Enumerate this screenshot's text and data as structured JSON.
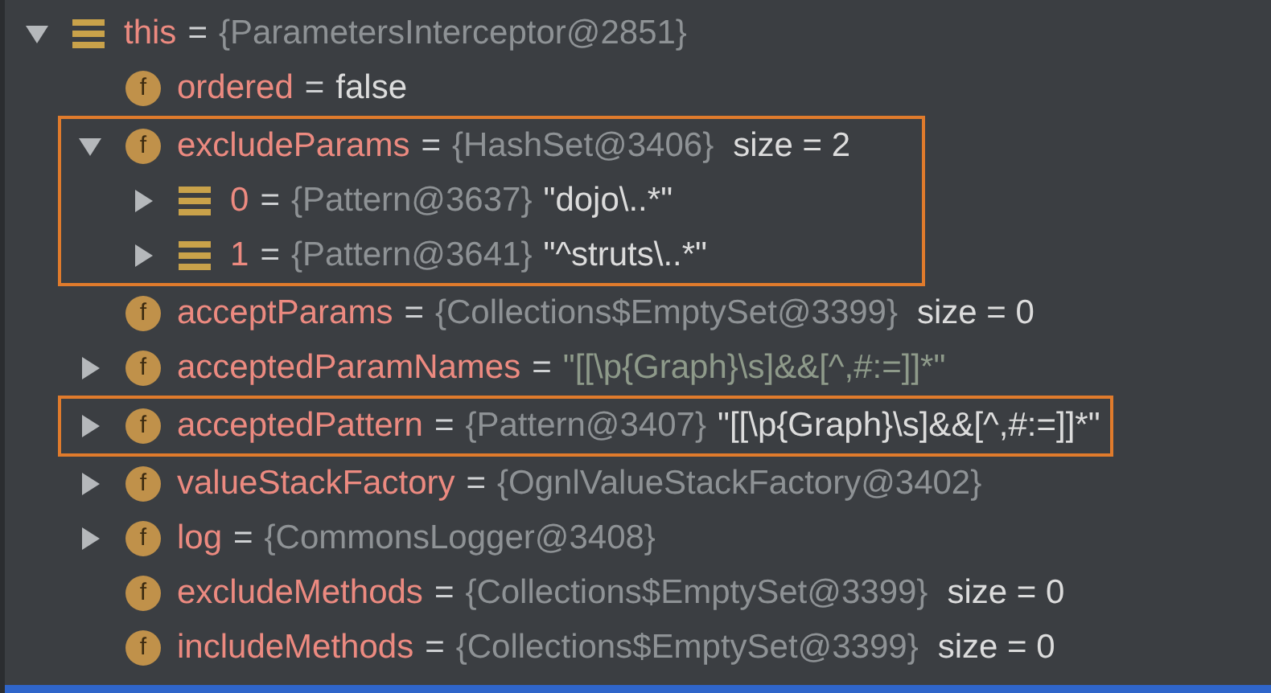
{
  "tree": [
    {
      "kind": "object",
      "name": "this",
      "eq": "=",
      "type": "{ParametersInterceptor@2851}",
      "has_children": true,
      "expanded": true,
      "highlighted": false,
      "children": [
        {
          "kind": "field",
          "badge": "f",
          "name": "ordered",
          "eq": "=",
          "value": "false",
          "has_children": false,
          "highlighted": false
        },
        {
          "kind": "field",
          "badge": "f",
          "name": "excludeParams",
          "eq": "=",
          "type": "{HashSet@3406}",
          "size": "size = 2",
          "has_children": true,
          "expanded": true,
          "highlighted": true,
          "children": [
            {
              "kind": "object",
              "name": "0",
              "eq": "=",
              "type": "{Pattern@3637}",
              "value": "\"dojo\\..*\"",
              "has_children": true,
              "expanded": false,
              "highlighted": false
            },
            {
              "kind": "object",
              "name": "1",
              "eq": "=",
              "type": "{Pattern@3641}",
              "value": "\"^struts\\..*\"",
              "has_children": true,
              "expanded": false,
              "highlighted": false
            }
          ]
        },
        {
          "kind": "field",
          "badge": "f",
          "name": "acceptParams",
          "eq": "=",
          "type": "{Collections$EmptySet@3399}",
          "size": "size = 0",
          "has_children": false,
          "highlighted": false
        },
        {
          "kind": "field",
          "badge": "f",
          "name": "acceptedParamNames",
          "eq": "=",
          "value": "\"[[\\p{Graph}\\s]&&[^,#:=]]*\"",
          "value_muted": true,
          "has_children": true,
          "expanded": false,
          "highlighted": false
        },
        {
          "kind": "field",
          "badge": "f",
          "name": "acceptedPattern",
          "eq": "=",
          "type": "{Pattern@3407}",
          "value": "\"[[\\p{Graph}\\s]&&[^,#:=]]*\"",
          "has_children": true,
          "expanded": false,
          "highlighted": true
        },
        {
          "kind": "field",
          "badge": "f",
          "name": "valueStackFactory",
          "eq": "=",
          "type": "{OgnlValueStackFactory@3402}",
          "has_children": true,
          "expanded": false,
          "highlighted": false
        },
        {
          "kind": "field",
          "badge": "f",
          "name": "log",
          "eq": "=",
          "type": "{CommonsLogger@3408}",
          "has_children": true,
          "expanded": false,
          "highlighted": false
        },
        {
          "kind": "field",
          "badge": "f",
          "name": "excludeMethods",
          "eq": "=",
          "type": "{Collections$EmptySet@3399}",
          "size": "size = 0",
          "has_children": false,
          "highlighted": false
        },
        {
          "kind": "field",
          "badge": "f",
          "name": "includeMethods",
          "eq": "=",
          "type": "{Collections$EmptySet@3399}",
          "size": "size = 0",
          "has_children": false,
          "highlighted": false
        }
      ]
    }
  ]
}
